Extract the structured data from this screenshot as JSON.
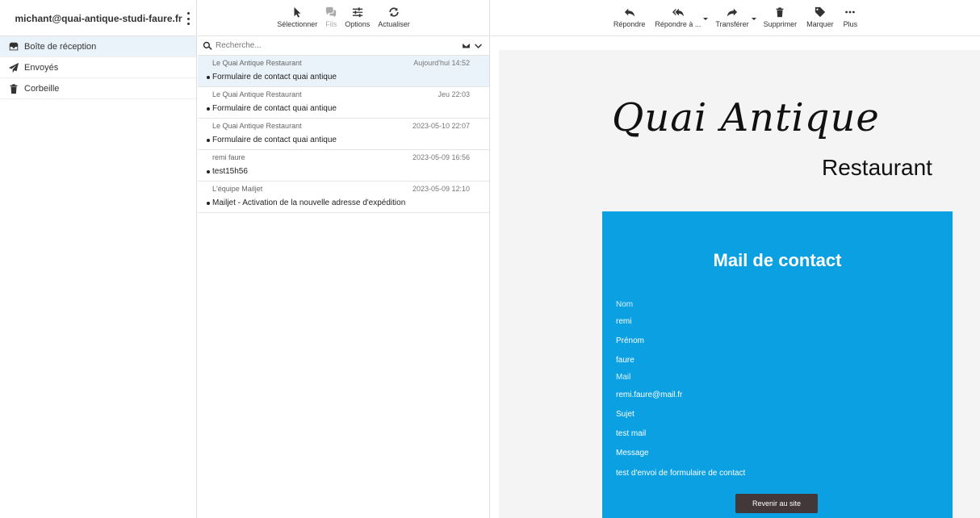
{
  "account": {
    "email": "michant@quai-antique-studi-faure.fr"
  },
  "folders": [
    {
      "label": "Boîte de réception",
      "icon": "inbox-icon",
      "active": true
    },
    {
      "label": "Envoyés",
      "icon": "send-icon",
      "active": false
    },
    {
      "label": "Corbeille",
      "icon": "trash-icon",
      "active": false
    }
  ],
  "list_toolbar": {
    "select": "Sélectionner",
    "threads": "Fils",
    "options": "Options",
    "refresh": "Actualiser"
  },
  "search": {
    "placeholder": "Recherche..."
  },
  "messages": [
    {
      "from": "Le Quai Antique Restaurant",
      "date": "Aujourd'hui 14:52",
      "subject": "Formulaire de contact quai antique",
      "active": true
    },
    {
      "from": "Le Quai Antique Restaurant",
      "date": "Jeu 22:03",
      "subject": "Formulaire de contact quai antique",
      "active": false
    },
    {
      "from": "Le Quai Antique Restaurant",
      "date": "2023-05-10 22:07",
      "subject": "Formulaire de contact quai antique",
      "active": false
    },
    {
      "from": "remi faure",
      "date": "2023-05-09 16:56",
      "subject": "test15h56",
      "active": false
    },
    {
      "from": "L'équipe Mailjet",
      "date": "2023-05-09 12:10",
      "subject": "Mailjet - Activation de la nouvelle adresse d'expédition",
      "active": false
    }
  ],
  "message_toolbar": {
    "reply": "Répondre",
    "reply_all": "Répondre à ...",
    "forward": "Transférer",
    "delete": "Supprimer",
    "mark": "Marquer",
    "more": "Plus"
  },
  "email": {
    "logo_script": "Quai Antique",
    "logo_sub": "Restaurant",
    "card_title": "Mail de contact",
    "fields": {
      "nom_label": "Nom",
      "nom_value": "remi",
      "prenom_label": "Prénom",
      "prenom_value": "faure",
      "mail_label": "Mail",
      "mail_value": "remi.faure@mail.fr",
      "sujet_label": "Sujet",
      "sujet_value": "test mail",
      "message_label": "Message",
      "message_value": "test d'envoi de formulaire de contact"
    },
    "button": "Revenir au site"
  },
  "colors": {
    "accent": "#0aa0e2",
    "selected": "#e9f3f9",
    "button": "#42383a",
    "email_bg": "#f4f4f4"
  }
}
